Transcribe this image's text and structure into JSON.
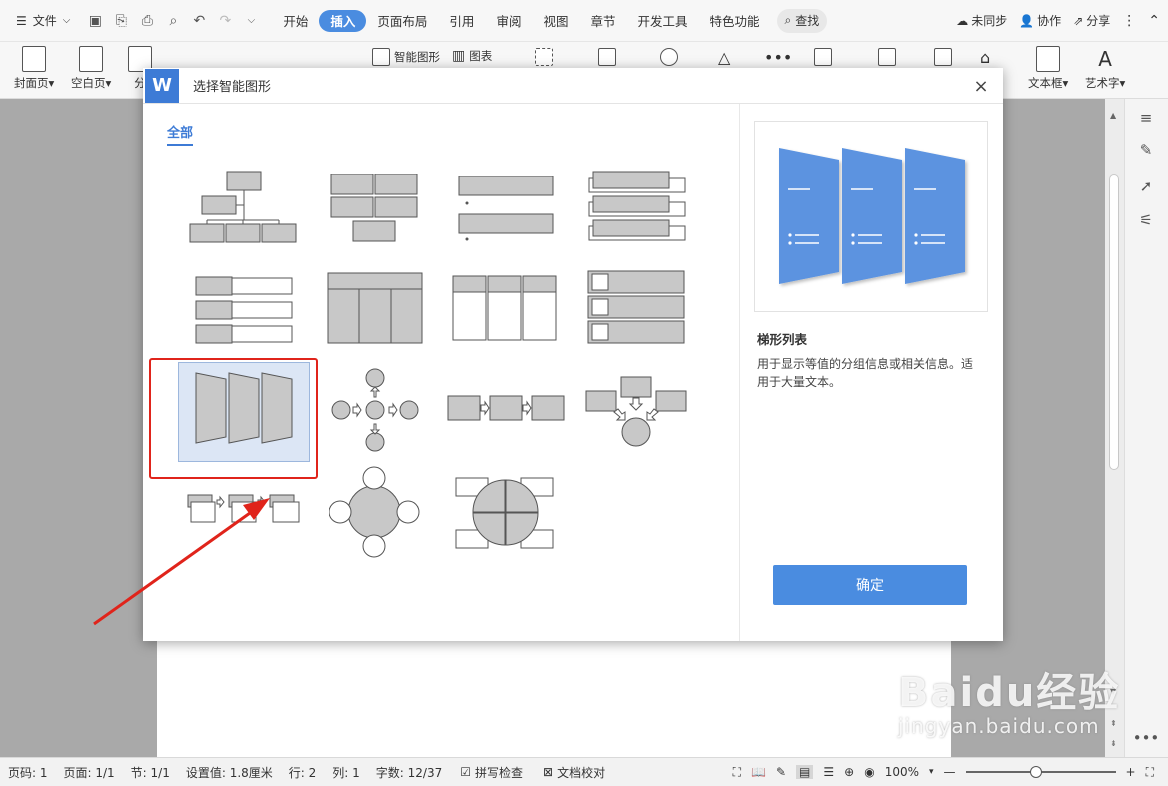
{
  "menu": {
    "file_label": "文件",
    "tabs": [
      {
        "label": "开始"
      },
      {
        "label": "插入",
        "active": true
      },
      {
        "label": "页面布局"
      },
      {
        "label": "引用"
      },
      {
        "label": "审阅"
      },
      {
        "label": "视图"
      },
      {
        "label": "章节"
      },
      {
        "label": "开发工具"
      },
      {
        "label": "特色功能"
      }
    ],
    "search_label": "查找",
    "sync_label": "未同步",
    "collab_label": "协作",
    "share_label": "分享"
  },
  "ribbon": {
    "cover_label": "封面页",
    "blank_label": "空白页",
    "break_label": "分",
    "smartart_label": "智能图形",
    "chart_label": "图表",
    "textbox_label": "文本框",
    "wordart_label": "艺术字"
  },
  "dialog": {
    "logo": "W",
    "title": "选择智能图形",
    "close_symbol": "×",
    "category_tab": "全部",
    "selected_name": "梯形列表",
    "selected_desc": "用于显示等值的分组信息或相关信息。适用于大量文本。",
    "ok_label": "确定"
  },
  "statusbar": {
    "page_code": "页码: 1",
    "pages": "页面: 1/1",
    "section": "节: 1/1",
    "setting": "设置值: 1.8厘米",
    "row": "行: 2",
    "col": "列: 1",
    "words": "字数: 12/37",
    "spell": "拼写检查",
    "proof": "文档校对",
    "zoom": "100%"
  },
  "watermark": {
    "top": "Baidu经验",
    "bottom": "jingyan.baidu.com"
  },
  "colors": {
    "accent": "#4a8ce0",
    "selection_frame": "#e0241b",
    "preview_shape": "#5b93e0",
    "thumb_fill": "#c8c8c8"
  }
}
